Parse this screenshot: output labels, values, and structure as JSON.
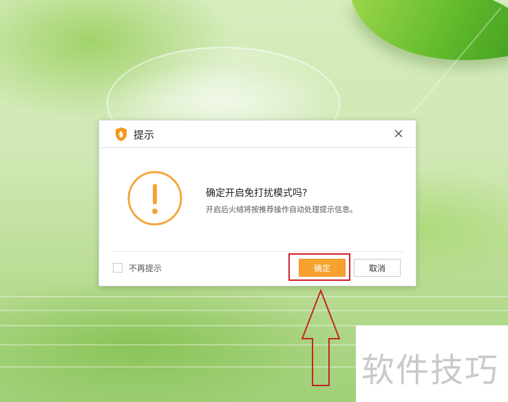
{
  "dialog": {
    "title": "提示",
    "message_title": "确定开启免打扰模式吗?",
    "message_detail": "开启后火绒将按推荐操作自动处理提示信息。",
    "checkbox_label": "不再提示",
    "confirm_label": "确定",
    "cancel_label": "取消",
    "checkbox_checked": false
  },
  "icons": {
    "app": "huorong-shield-icon",
    "close": "close-icon",
    "warning": "warning-exclamation-icon"
  },
  "colors": {
    "accent_orange": "#f7a12f",
    "annotation_red": "#d0202a"
  },
  "watermark": {
    "text": "软件技巧"
  }
}
